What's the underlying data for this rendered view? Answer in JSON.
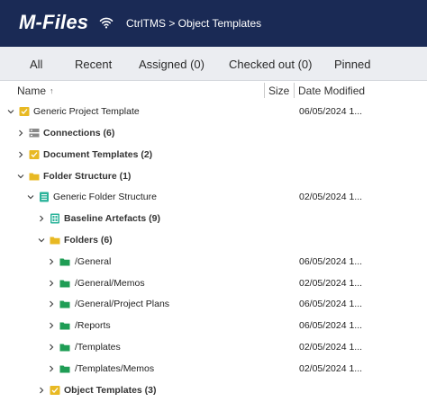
{
  "header": {
    "logo_text": "M-Files",
    "breadcrumb": "CtrlTMS > Object Templates"
  },
  "tabs": [
    "All",
    "Recent",
    "Assigned (0)",
    "Checked out (0)",
    "Pinned"
  ],
  "columns": {
    "name": "Name",
    "size": "Size",
    "date": "Date Modified"
  },
  "rows": [
    {
      "label": "Generic Project Template",
      "date": "06/05/2024 1...",
      "icon": "project-template-icon"
    },
    {
      "label": "Connections (6)",
      "date": "",
      "icon": "server-icon"
    },
    {
      "label": "Document Templates (2)",
      "date": "",
      "icon": "template-icon"
    },
    {
      "label": "Folder Structure (1)",
      "date": "",
      "icon": "folder-icon"
    },
    {
      "label": "Generic Folder Structure",
      "date": "02/05/2024 1...",
      "icon": "structure-icon"
    },
    {
      "label": "Baseline Artefacts (9)",
      "date": "",
      "icon": "artefact-icon"
    },
    {
      "label": "Folders (6)",
      "date": "",
      "icon": "folder-icon"
    },
    {
      "label": "/General",
      "date": "06/05/2024 1...",
      "icon": "green-folder-icon"
    },
    {
      "label": "/General/Memos",
      "date": "02/05/2024 1...",
      "icon": "green-folder-icon"
    },
    {
      "label": "/General/Project Plans",
      "date": "06/05/2024 1...",
      "icon": "green-folder-icon"
    },
    {
      "label": "/Reports",
      "date": "06/05/2024 1...",
      "icon": "green-folder-icon"
    },
    {
      "label": "/Templates",
      "date": "02/05/2024 1...",
      "icon": "green-folder-icon"
    },
    {
      "label": "/Templates/Memos",
      "date": "02/05/2024 1...",
      "icon": "green-folder-icon"
    },
    {
      "label": "Object Templates (3)",
      "date": "",
      "icon": "template-icon"
    }
  ],
  "colors": {
    "header_bg": "#1a2a55",
    "tab_bg": "#ebedf1",
    "folder_yellow": "#e8b923",
    "folder_green": "#1f9d55",
    "structure_teal": "#2bb39a"
  }
}
